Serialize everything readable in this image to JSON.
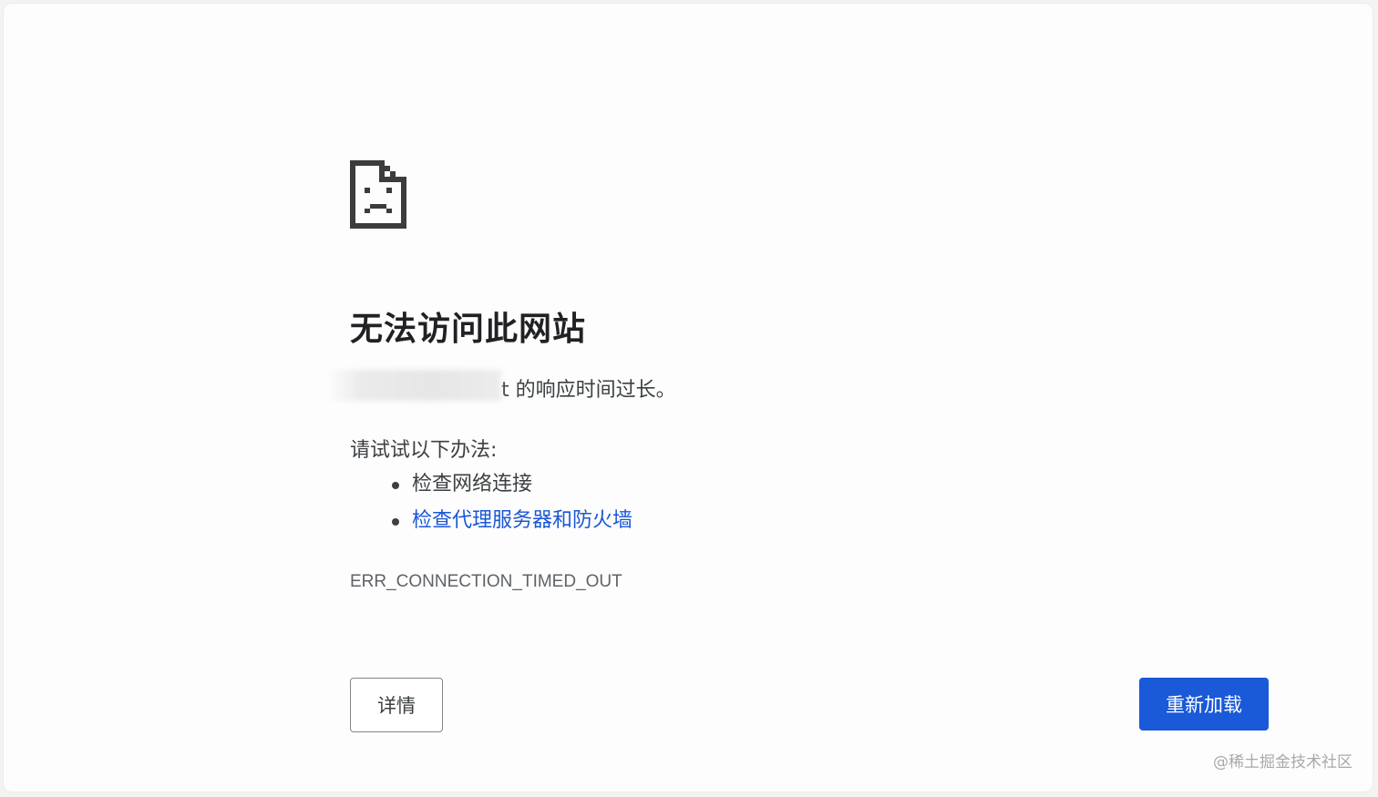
{
  "error_page": {
    "icon": "sad-document-icon",
    "title": "无法访问此网站",
    "summary_text": "t 的响应时间过长。",
    "suggestions_heading": "请试试以下办法:",
    "suggestions": [
      {
        "label": "检查网络连接",
        "is_link": false
      },
      {
        "label": "检查代理服务器和防火墙",
        "is_link": true
      }
    ],
    "error_code": "ERR_CONNECTION_TIMED_OUT",
    "details_button": "详情",
    "reload_button": "重新加载"
  },
  "watermark": "@稀土掘金技术社区",
  "colors": {
    "background": "#fdfdfd",
    "text_primary": "#202124",
    "text_secondary": "#3c4043",
    "link": "#1a57d6",
    "reload_button_bg": "#1a59d8",
    "error_code_text": "#5f6368"
  }
}
